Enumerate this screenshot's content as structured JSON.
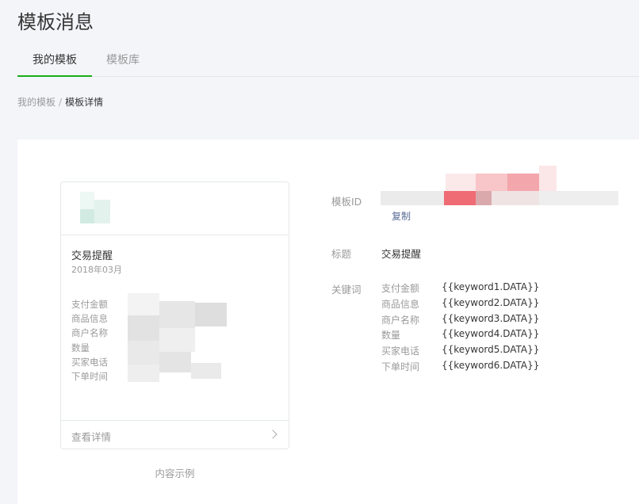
{
  "header": {
    "title": "模板消息"
  },
  "tabs": [
    {
      "label": "我的模板"
    },
    {
      "label": "模板库"
    }
  ],
  "breadcrumb": {
    "parent": "我的模板",
    "separator": "/",
    "current": "模板详情"
  },
  "preview": {
    "title": "交易提醒",
    "date": "2018年03月",
    "fields": [
      "支付金额",
      "商品信息",
      "商户名称",
      "数量",
      "买家电话",
      "下单时间"
    ],
    "footer_link": "查看详情",
    "caption": "内容示例"
  },
  "detail": {
    "id_label": "模板ID",
    "copy_label": "复制",
    "title_label": "标题",
    "title_value": "交易提醒",
    "keywords_label": "关键词",
    "keywords": [
      {
        "name": "支付金额",
        "value": "{{keyword1.DATA}}"
      },
      {
        "name": "商品信息",
        "value": "{{keyword2.DATA}}"
      },
      {
        "name": "商户名称",
        "value": "{{keyword3.DATA}}"
      },
      {
        "name": "数量",
        "value": "{{keyword4.DATA}}"
      },
      {
        "name": "买家电话",
        "value": "{{keyword5.DATA}}"
      },
      {
        "name": "下单时间",
        "value": "{{keyword6.DATA}}"
      }
    ]
  },
  "colors": {
    "accent": "#1aad19",
    "link": "#576b95",
    "muted": "#9a9a9a",
    "text": "#353535"
  }
}
